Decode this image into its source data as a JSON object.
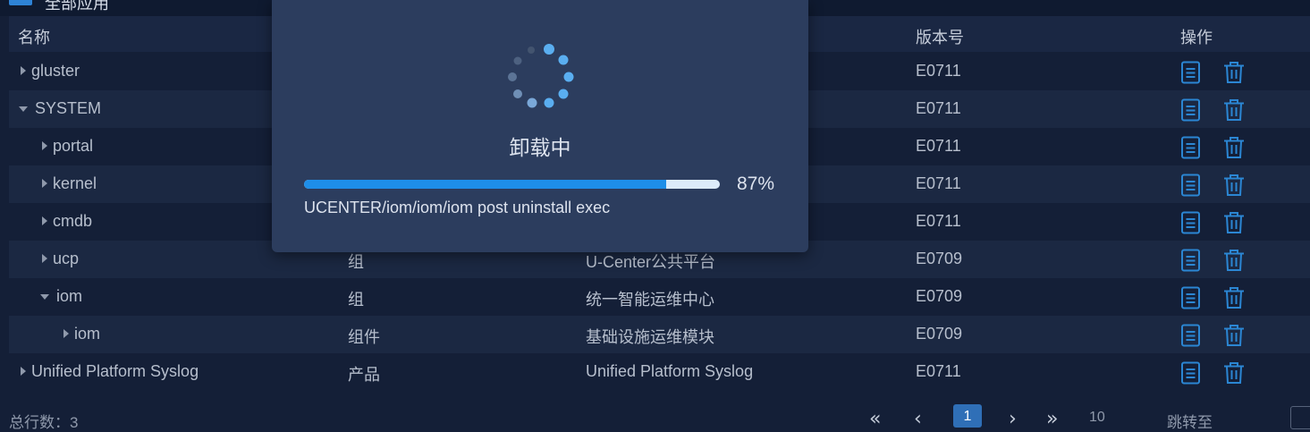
{
  "header_strip": {
    "title": "全部应用"
  },
  "table": {
    "columns": {
      "name": "名称",
      "version": "版本号",
      "actions": "操作"
    },
    "rows": [
      {
        "name": "gluster",
        "type": "",
        "desc": "",
        "version": "E0711",
        "caret": "right"
      },
      {
        "name": "SYSTEM",
        "type": "",
        "desc": "",
        "version": "E0711",
        "caret": "down"
      },
      {
        "name": "portal",
        "type": "",
        "desc": "",
        "version": "E0711",
        "caret": "right"
      },
      {
        "name": "kernel",
        "type": "",
        "desc": "",
        "version": "E0711",
        "caret": "right"
      },
      {
        "name": "cmdb",
        "type": "",
        "desc": "",
        "version": "E0711",
        "caret": "right"
      },
      {
        "name": "ucp",
        "type": "组",
        "desc": "U-Center公共平台",
        "version": "E0709",
        "caret": "right"
      },
      {
        "name": "iom",
        "type": "组",
        "desc": "统一智能运维中心",
        "version": "E0709",
        "caret": "down"
      },
      {
        "name": "iom",
        "type": "组件",
        "desc": "基础设施运维模块",
        "version": "E0709",
        "caret": "right"
      },
      {
        "name": "Unified Platform Syslog",
        "type": "产品",
        "desc": "Unified Platform Syslog",
        "version": "E0711",
        "caret": "right"
      }
    ],
    "action_icons": [
      "detail-icon",
      "delete-icon"
    ]
  },
  "footer": {
    "total_label": "总行数：3",
    "first_icon": "«",
    "prev_icon": "‹",
    "current_page": "1",
    "next_icon": "›",
    "last_icon": "»",
    "page_size": "10",
    "jump_label": "跳转至"
  },
  "dialog": {
    "loading_text": "卸载中",
    "progress_percent": 87,
    "progress_label": "87%",
    "progress_message": "UCENTER/iom/iom/iom post uninstall exec"
  },
  "colors": {
    "accent": "#1e8ee8",
    "icon": "#2b86d3",
    "background": "#141f37",
    "dialog": "#2c3d5e"
  }
}
